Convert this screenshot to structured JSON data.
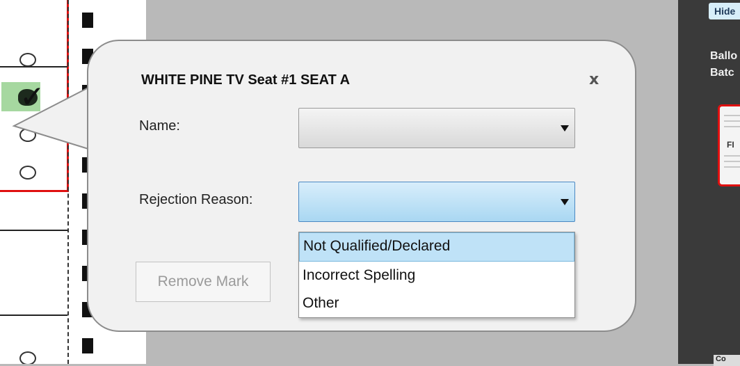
{
  "dialog": {
    "title": "WHITE PINE TV Seat #1 SEAT A",
    "close_label": "x",
    "name_label": "Name:",
    "name_value": "",
    "rejection_label": "Rejection Reason:",
    "rejection_value": "",
    "remove_label": "Remove Mark",
    "options": [
      {
        "label": "Not Qualified/Declared",
        "highlighted": true
      },
      {
        "label": "Incorrect Spelling",
        "highlighted": false
      },
      {
        "label": "Other",
        "highlighted": false
      }
    ]
  },
  "right_panel": {
    "hide_label": "Hide",
    "ballot_label": "Ballo",
    "batch_label": "Batc",
    "thumb_text": "FI",
    "bottom_tab": "Co"
  },
  "colors": {
    "highlight": "#bfe2f7",
    "selected_field": "#a9d7f2",
    "ballot_frame": "#e01010",
    "mark_fill": "#a6d8a0"
  }
}
